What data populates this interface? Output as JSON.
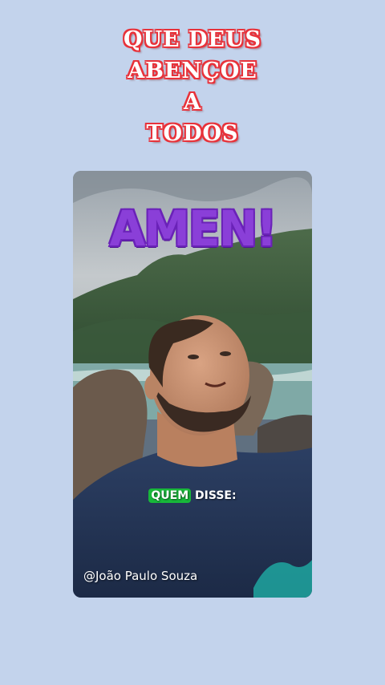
{
  "headline": {
    "lines": [
      "QUE DEUS",
      "ABENÇOE",
      "A",
      "TODOS"
    ]
  },
  "video": {
    "sticker_text": "AMEN!",
    "caption_highlight": "QUEM",
    "caption_rest": " DISSE:",
    "watermark": "@João Paulo Souza"
  },
  "colors": {
    "background": "#c3d3ec",
    "headline_outline": "#e8323a",
    "sticker_purple": "#8a3fd8",
    "caption_highlight": "#18b83a"
  }
}
